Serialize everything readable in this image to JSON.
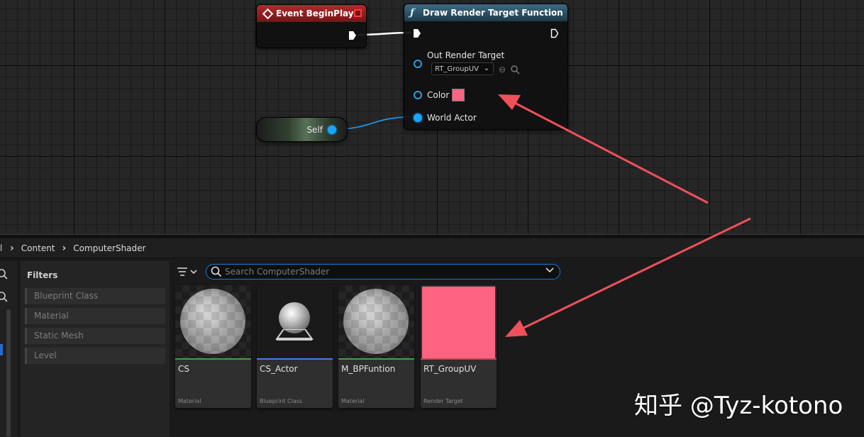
{
  "graph": {
    "event_node": {
      "title": "Event BeginPlay"
    },
    "function_node": {
      "title": "Draw Render Target Function",
      "out_render_target_label": "Out Render Target",
      "out_render_target_value": "RT_GroupUV",
      "color_label": "Color",
      "color_value": "#ff6382",
      "world_actor_label": "World Actor"
    },
    "self_node": {
      "label": "Self"
    }
  },
  "breadcrumb": {
    "items": [
      "Content",
      "ComputerShader"
    ]
  },
  "filters": {
    "title": "Filters",
    "items": [
      "Blueprint Class",
      "Material",
      "Static Mesh",
      "Level"
    ]
  },
  "search": {
    "placeholder": "Search ComputerShader"
  },
  "assets": [
    {
      "name": "CS",
      "type": "Material",
      "bar_color": "#3ea341"
    },
    {
      "name": "CS_Actor",
      "type": "Blueprint Class",
      "bar_color": "#3f7fe0"
    },
    {
      "name": "M_BPFuntion",
      "type": "Material",
      "bar_color": "#3ea341"
    },
    {
      "name": "RT_GroupUV",
      "type": "Render Target",
      "bar_color": "#c8464e"
    }
  ],
  "annotation_color": "#f0505a",
  "watermark": "知乎 @Tyz-kotono"
}
